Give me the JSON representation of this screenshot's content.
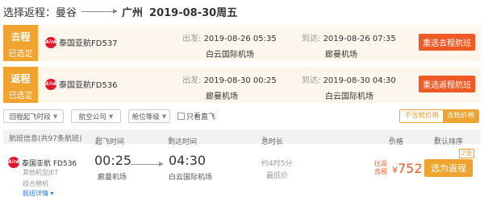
{
  "header": {
    "prefix": "选择返程：曼谷",
    "dest": "广州",
    "date": "2019-08-30周五"
  },
  "segments": [
    {
      "tag_title": "去程",
      "tag_status": "已选定",
      "airline": "泰国亚航FD537",
      "dep_label": "出发:",
      "dep_time": "2019-08-26 05:35",
      "dep_airport": "白云国际机场",
      "arr_label": "到达:",
      "arr_time": "2019-08-26 07:35",
      "arr_airport": "廊曼机场",
      "button": "重选去程航班"
    },
    {
      "tag_title": "返程",
      "tag_status": "已选定",
      "airline": "泰国亚航FD536",
      "dep_label": "出发:",
      "dep_time": "2019-08-30 00:25",
      "dep_airport": "廊曼机场",
      "arr_label": "到达:",
      "arr_time": "2019-08-30 04:30",
      "arr_airport": "白云国际机场",
      "button": "重选返程航班"
    }
  ],
  "filters": {
    "dropdowns": [
      "回程起飞时段",
      "航空公司",
      "舱位等级"
    ],
    "direct_only": "只看直飞",
    "price_excl": "不含税价格",
    "price_incl": "含税价格"
  },
  "table": {
    "headers": {
      "flight_info": "航班信息(共97条航班)",
      "dep_time": "起飞时间",
      "arr_time": "到达时间",
      "duration": "总时长",
      "price": "价格",
      "sort": "默认排序"
    },
    "rows": [
      {
        "airline": "泰国亚航 FD536",
        "plane": "其他机型JET",
        "combo": "组合替机",
        "detail": "航班详情",
        "dep_time": "00:25",
        "dep_airport": "廊曼机场",
        "arr_time": "04:30",
        "arr_airport": "白云国际机场",
        "duration": "约4时5分",
        "ontime": "最低价",
        "price_label_1": "往返",
        "price_label_2": "含税",
        "currency": "¥",
        "price": "752",
        "stock": "2张",
        "button": "选为返程"
      }
    ]
  },
  "colors": {
    "accent_orange": "#f0a32f",
    "button_red": "#f15a24",
    "airline_red": "#e0142b",
    "link_blue": "#2577e3"
  },
  "icons": {
    "airline_logo": "airasia-logo-icon",
    "dropdown": "chevron-down-icon",
    "sort": "sort-icon"
  },
  "logo_text": "AirAsia"
}
